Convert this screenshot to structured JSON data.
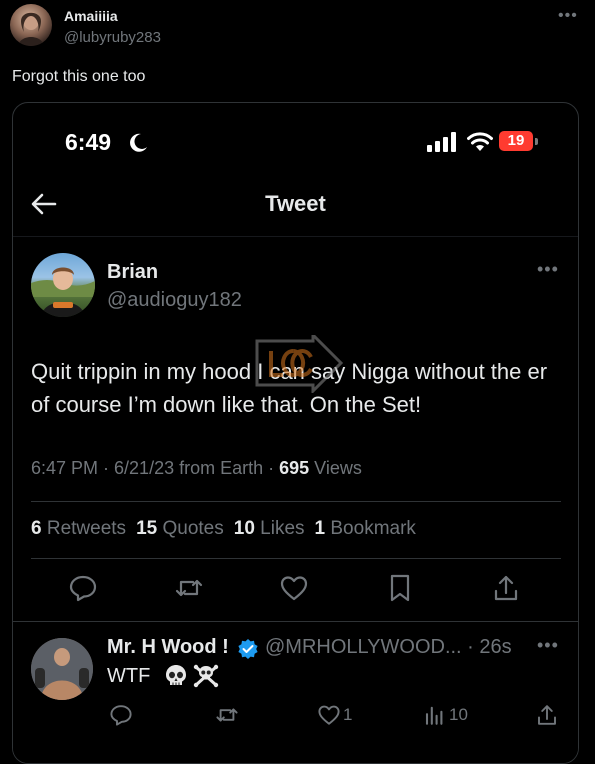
{
  "outer_post": {
    "author_name": "Amaiiiia",
    "author_handle": "@lubyruby283",
    "more_icon": "more-horizontal-icon",
    "text": "Forgot this one too"
  },
  "screenshot": {
    "status_bar": {
      "time": "6:49",
      "moon_icon": "moon-icon",
      "signal_icon": "signal-bars-icon",
      "wifi_icon": "wifi-icon",
      "battery_level": "19",
      "battery_color": "#ff3b30"
    },
    "nav": {
      "back_icon": "back-arrow-icon",
      "title": "Tweet"
    },
    "tweet": {
      "author_name": "Brian",
      "author_handle": "@audioguy182",
      "more_icon": "more-horizontal-icon",
      "body": "Quit trippin in my hood I can say Nigga without the er of course I’m down like that. On the Set!",
      "watermark_icon": "watermark-logo-icon",
      "meta_prefix": "6:47 PM · 6/21/23 from Earth · ",
      "views_count": "695",
      "views_label": " Views",
      "stats": {
        "retweets_count": "6",
        "retweets_label": " Retweets",
        "quotes_count": "15",
        "quotes_label": " Quotes",
        "likes_count": "10",
        "likes_label": " Likes",
        "bookmarks_count": "1",
        "bookmarks_label": " Bookmark"
      },
      "actions": [
        "reply-icon",
        "retweet-icon",
        "like-icon",
        "bookmark-icon",
        "share-icon"
      ]
    },
    "reply": {
      "author_name": "Mr. H Wood !",
      "verified_icon": "verified-badge-icon",
      "verified_color": "#1d9bf0",
      "author_handle": "@MRHOLLYWOOD...",
      "time_sep": " · ",
      "time": "26s",
      "more_icon": "more-horizontal-icon",
      "text": "WTF",
      "emoji": [
        "skull-emoji-icon",
        "skull-crossbones-emoji-icon"
      ],
      "like_count": "1",
      "views_count": "10",
      "actions": [
        "reply-icon",
        "retweet-icon",
        "like-icon",
        "views-icon",
        "share-icon"
      ]
    }
  },
  "colors": {
    "background": "#000000",
    "text_primary": "#e7e9ea",
    "text_secondary": "#71767b",
    "border": "#2f3336"
  }
}
